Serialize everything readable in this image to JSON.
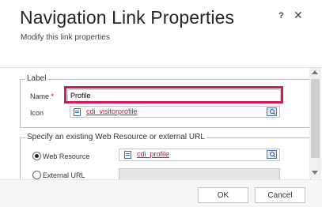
{
  "dialog": {
    "title": "Navigation Link Properties",
    "subtitle": "Modify this link properties",
    "help_label": "?",
    "close_label": "✕"
  },
  "label_group": {
    "legend": "Label",
    "name_label": "Name",
    "required_mark": "*",
    "name_value": "Profile",
    "icon_label": "Icon",
    "icon_value": "cdi_visitorprofile"
  },
  "url_group": {
    "legend": "Specify an existing Web Resource or external URL",
    "web_resource_label": "Web Resource",
    "web_resource_value": "cdi_profile",
    "web_resource_selected": true,
    "external_url_label": "External URL",
    "external_url_value": ""
  },
  "footer": {
    "ok_label": "OK",
    "cancel_label": "Cancel"
  },
  "colors": {
    "highlight": "#d1195b",
    "lookup_text": "#c0143c"
  }
}
